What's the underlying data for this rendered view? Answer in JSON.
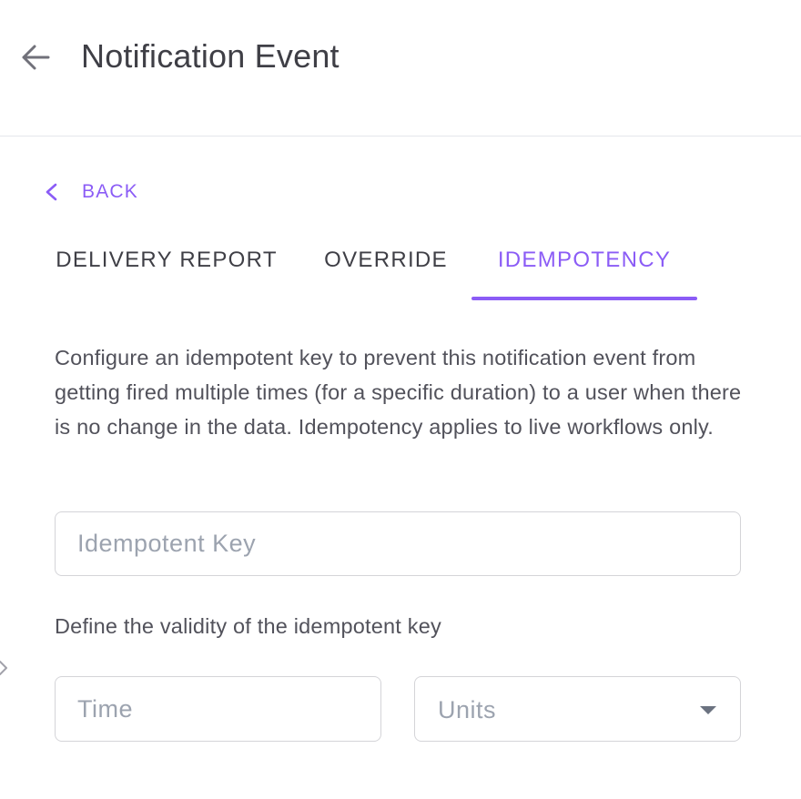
{
  "header": {
    "title": "Notification Event",
    "back_icon": "arrow-left-icon"
  },
  "back_link": {
    "label": "BACK",
    "icon": "chevron-left-icon"
  },
  "tabs": [
    {
      "label": "DELIVERY REPORT",
      "active": false
    },
    {
      "label": "OVERRIDE",
      "active": false
    },
    {
      "label": "IDEMPOTENCY",
      "active": true
    }
  ],
  "idempotency": {
    "description": "Configure an idempotent key to prevent this notification event from getting fired multiple times (for a specific duration) to a user when there is no change in the data. Idempotency applies to live workflows only.",
    "key_placeholder": "Idempotent Key",
    "key_value": "",
    "validity_label": "Define the validity of the idempotent key",
    "time_placeholder": "Time",
    "time_value": "",
    "units_placeholder": "Units"
  },
  "colors": {
    "accent": "#8b5cf6",
    "text": "#3f3f46",
    "border": "#d4d4d8"
  }
}
